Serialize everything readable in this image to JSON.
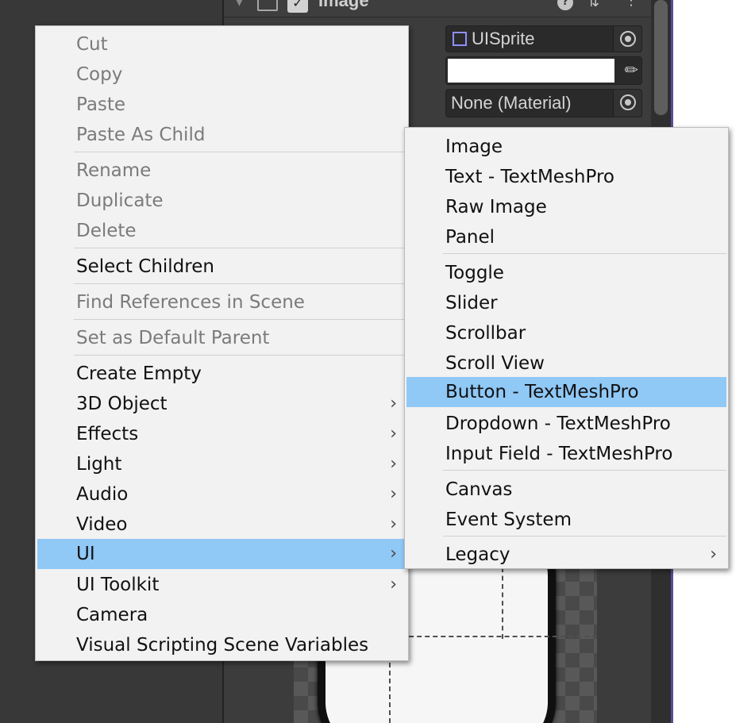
{
  "inspector": {
    "component_title": "Image",
    "source_image_value": "UISprite",
    "color_value": "#ffffff",
    "material_value": "None (Material)",
    "checkbox_glyph": "✓",
    "help_glyph": "?",
    "preset_glyph": "⇅",
    "more_glyph": "⋮",
    "foldout_glyph": "▼",
    "eyedropper_glyph": "✎"
  },
  "context_menu": {
    "arrow_glyph": "›",
    "items": [
      {
        "label": "Cut",
        "disabled": true
      },
      {
        "label": "Copy",
        "disabled": true
      },
      {
        "label": "Paste",
        "disabled": true
      },
      {
        "label": "Paste As Child",
        "disabled": true
      },
      {
        "label": "Rename",
        "disabled": true
      },
      {
        "label": "Duplicate",
        "disabled": true
      },
      {
        "label": "Delete",
        "disabled": true
      },
      {
        "label": "Select Children",
        "disabled": false
      },
      {
        "label": "Find References in Scene",
        "disabled": true
      },
      {
        "label": "Set as Default Parent",
        "disabled": true
      },
      {
        "label": "Create Empty",
        "disabled": false
      },
      {
        "label": "3D Object",
        "disabled": false,
        "submenu": true
      },
      {
        "label": "Effects",
        "disabled": false,
        "submenu": true
      },
      {
        "label": "Light",
        "disabled": false,
        "submenu": true
      },
      {
        "label": "Audio",
        "disabled": false,
        "submenu": true
      },
      {
        "label": "Video",
        "disabled": false,
        "submenu": true
      },
      {
        "label": "UI",
        "disabled": false,
        "submenu": true,
        "selected": true
      },
      {
        "label": "UI Toolkit",
        "disabled": false,
        "submenu": true
      },
      {
        "label": "Camera",
        "disabled": false
      },
      {
        "label": "Visual Scripting Scene Variables",
        "disabled": false
      }
    ]
  },
  "ui_submenu": {
    "items": [
      {
        "label": "Image"
      },
      {
        "label": "Text - TextMeshPro"
      },
      {
        "label": "Raw Image"
      },
      {
        "label": "Panel"
      },
      {
        "label": "Toggle"
      },
      {
        "label": "Slider"
      },
      {
        "label": "Scrollbar"
      },
      {
        "label": "Scroll View"
      },
      {
        "label": "Button - TextMeshPro",
        "selected": true
      },
      {
        "label": "Dropdown - TextMeshPro"
      },
      {
        "label": "Input Field - TextMeshPro"
      },
      {
        "label": "Canvas"
      },
      {
        "label": "Event System"
      },
      {
        "label": "Legacy",
        "submenu": true
      }
    ]
  },
  "colors": {
    "menu_background": "#f2f2f2",
    "highlight": "#90c8f6",
    "disabled_text": "#7b7b7b",
    "editor_background": "#383838"
  }
}
